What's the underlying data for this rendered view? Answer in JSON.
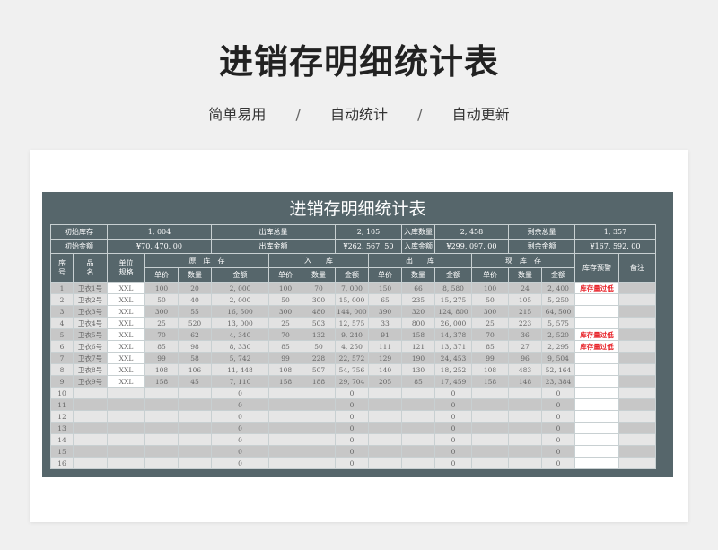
{
  "header": {
    "title": "进销存明细统计表",
    "subtitle_items": [
      "简单易用",
      "自动统计",
      "自动更新"
    ],
    "separator": "/"
  },
  "sheet": {
    "title": "进销存明细统计表",
    "summary": {
      "row1": [
        {
          "label": "初始库存",
          "value": "1, 004"
        },
        {
          "label": "出库总量",
          "value": "2, 105"
        },
        {
          "label": "入库数量",
          "value": "2, 458"
        },
        {
          "label": "剩余总量",
          "value": "1, 357"
        }
      ],
      "row2": [
        {
          "label": "初始金额",
          "value": "¥70, 470. 00"
        },
        {
          "label": "出库金额",
          "value": "¥262, 567. 50"
        },
        {
          "label": "入库金额",
          "value": "¥299, 097. 00"
        },
        {
          "label": "剩余金额",
          "value": "¥167, 592. 00"
        }
      ]
    },
    "columns": {
      "index": "序\n号",
      "name": "品\n名",
      "unit": "单位\n规格",
      "groups": [
        "原　库　存",
        "入　　库",
        "出　　库",
        "现　库　存"
      ],
      "sub": [
        "单价",
        "数量",
        "金额"
      ],
      "warning": "库存预警",
      "note": "备注"
    },
    "rows": [
      {
        "idx": "1",
        "name": "卫衣1号",
        "unit": "XXL",
        "o": [
          "100",
          "20",
          "2, 000"
        ],
        "i": [
          "100",
          "70",
          "7, 000"
        ],
        "x": [
          "150",
          "66",
          "8, 580"
        ],
        "c": [
          "100",
          "24",
          "2, 400"
        ],
        "warn": "库存量过低"
      },
      {
        "idx": "2",
        "name": "卫衣2号",
        "unit": "XXL",
        "o": [
          "50",
          "40",
          "2, 000"
        ],
        "i": [
          "50",
          "300",
          "15, 000"
        ],
        "x": [
          "65",
          "235",
          "15, 275"
        ],
        "c": [
          "50",
          "105",
          "5, 250"
        ],
        "warn": ""
      },
      {
        "idx": "3",
        "name": "卫衣3号",
        "unit": "XXL",
        "o": [
          "300",
          "55",
          "16, 500"
        ],
        "i": [
          "300",
          "480",
          "144, 000"
        ],
        "x": [
          "390",
          "320",
          "124, 800"
        ],
        "c": [
          "300",
          "215",
          "64, 500"
        ],
        "warn": ""
      },
      {
        "idx": "4",
        "name": "卫衣4号",
        "unit": "XXL",
        "o": [
          "25",
          "520",
          "13, 000"
        ],
        "i": [
          "25",
          "503",
          "12, 575"
        ],
        "x": [
          "33",
          "800",
          "26, 000"
        ],
        "c": [
          "25",
          "223",
          "5, 575"
        ],
        "warn": ""
      },
      {
        "idx": "5",
        "name": "卫衣5号",
        "unit": "XXL",
        "o": [
          "70",
          "62",
          "4, 340"
        ],
        "i": [
          "70",
          "132",
          "9, 240"
        ],
        "x": [
          "91",
          "158",
          "14, 378"
        ],
        "c": [
          "70",
          "36",
          "2, 520"
        ],
        "warn": "库存量过低"
      },
      {
        "idx": "6",
        "name": "卫衣6号",
        "unit": "XXL",
        "o": [
          "85",
          "98",
          "8, 330"
        ],
        "i": [
          "85",
          "50",
          "4, 250"
        ],
        "x": [
          "111",
          "121",
          "13, 371"
        ],
        "c": [
          "85",
          "27",
          "2, 295"
        ],
        "warn": "库存量过低"
      },
      {
        "idx": "7",
        "name": "卫衣7号",
        "unit": "XXL",
        "o": [
          "99",
          "58",
          "5, 742"
        ],
        "i": [
          "99",
          "228",
          "22, 572"
        ],
        "x": [
          "129",
          "190",
          "24, 453"
        ],
        "c": [
          "99",
          "96",
          "9, 504"
        ],
        "warn": ""
      },
      {
        "idx": "8",
        "name": "卫衣8号",
        "unit": "XXL",
        "o": [
          "108",
          "106",
          "11, 448"
        ],
        "i": [
          "108",
          "507",
          "54, 756"
        ],
        "x": [
          "140",
          "130",
          "18, 252"
        ],
        "c": [
          "108",
          "483",
          "52, 164"
        ],
        "warn": ""
      },
      {
        "idx": "9",
        "name": "卫衣9号",
        "unit": "XXL",
        "o": [
          "158",
          "45",
          "7, 110"
        ],
        "i": [
          "158",
          "188",
          "29, 704"
        ],
        "x": [
          "205",
          "85",
          "17, 459"
        ],
        "c": [
          "158",
          "148",
          "23, 384"
        ],
        "warn": ""
      }
    ],
    "empty_rows": [
      "10",
      "11",
      "12",
      "13",
      "14",
      "15",
      "16"
    ],
    "zero": "0"
  }
}
